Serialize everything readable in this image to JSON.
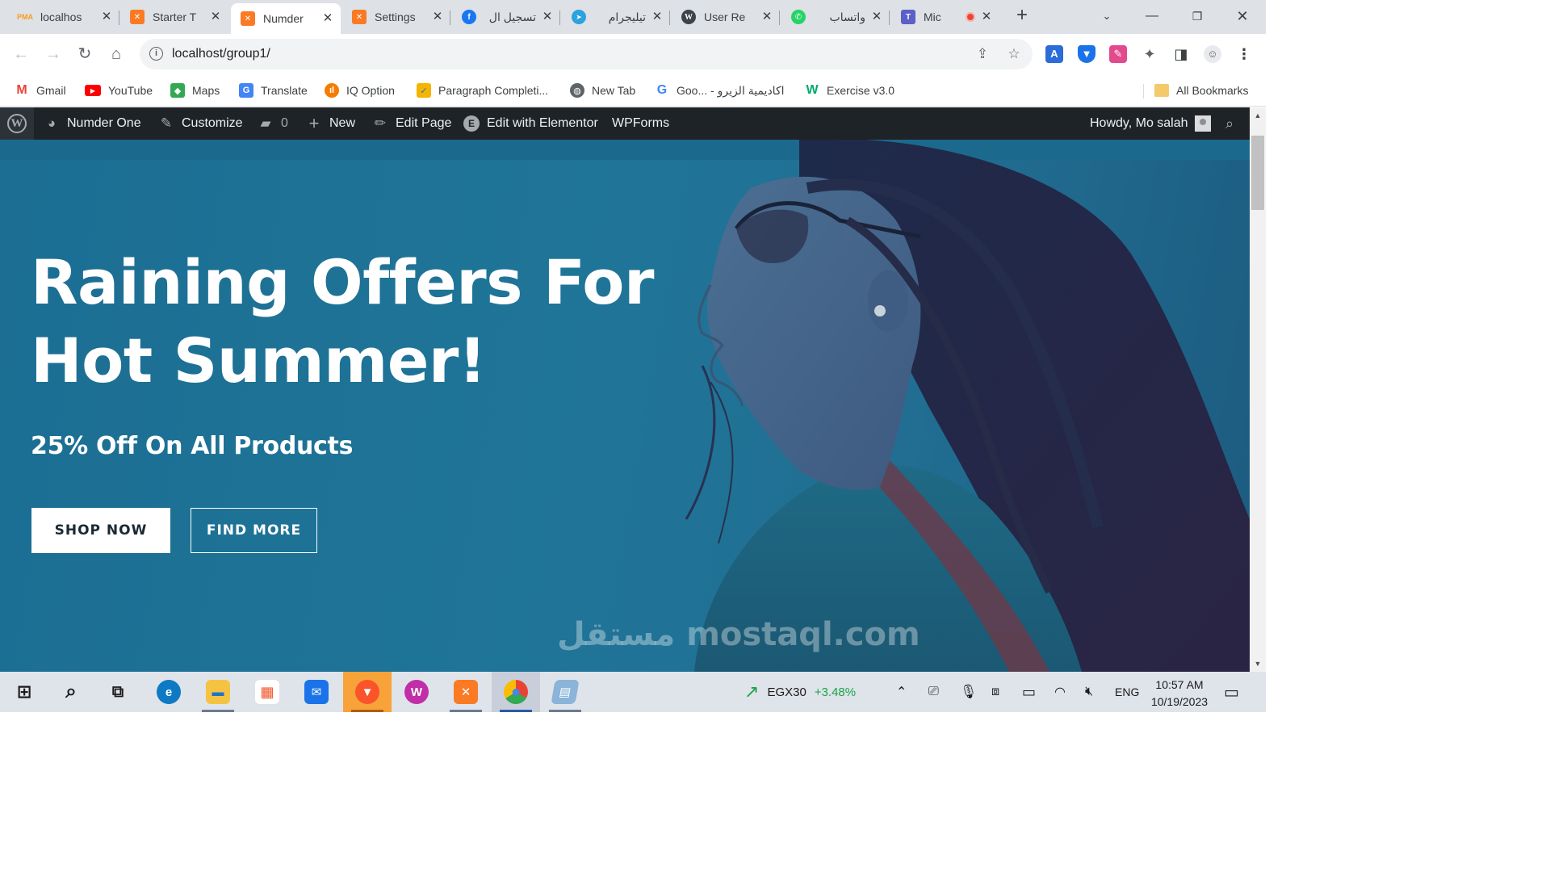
{
  "browser": {
    "tabs": [
      {
        "label": "localhos",
        "favicon": "phpmyadmin-icon",
        "color": "#f89c1c",
        "active": false
      },
      {
        "label": "Starter T",
        "favicon": "xampp-icon",
        "color": "#fb7a24",
        "active": false
      },
      {
        "label": "Numder",
        "favicon": "xampp-icon",
        "color": "#fb7a24",
        "active": true
      },
      {
        "label": "Settings",
        "favicon": "xampp-icon",
        "color": "#fb7a24",
        "active": false
      },
      {
        "label": "تسجيل ال",
        "favicon": "facebook-icon",
        "color": "#1877f2",
        "active": false
      },
      {
        "label": "تيليجرام",
        "favicon": "telegram-icon",
        "color": "#2aa3de",
        "active": false
      },
      {
        "label": "User Re",
        "favicon": "wordpress-icon",
        "color": "#3c434a",
        "active": false
      },
      {
        "label": "واتساب",
        "favicon": "whatsapp-icon",
        "color": "#25d366",
        "active": false
      },
      {
        "label": "Mic",
        "favicon": "teams-icon",
        "color": "#5b5fc7",
        "active": false
      }
    ],
    "tab_close_glyph": "✕",
    "new_tab_glyph": "+",
    "url": "localhost/group1/",
    "bookmarks": [
      {
        "label": "Gmail",
        "icon": "gmail-icon",
        "color": "#ea4335"
      },
      {
        "label": "YouTube",
        "icon": "youtube-icon",
        "color": "#ff0000"
      },
      {
        "label": "Maps",
        "icon": "maps-icon",
        "color": "#34a853"
      },
      {
        "label": "Translate",
        "icon": "translate-icon",
        "color": "#4285f4"
      },
      {
        "label": "IQ Option",
        "icon": "iqoption-icon",
        "color": "#f57c00"
      },
      {
        "label": "Paragraph Completi...",
        "icon": "checkbox-icon",
        "color": "#f4b400"
      },
      {
        "label": "New Tab",
        "icon": "globe-icon",
        "color": "#5f6368"
      },
      {
        "label": "Goo... - اكاديمية الزيرو",
        "icon": "google-icon",
        "color": "#4285f4"
      },
      {
        "label": "Exercise v3.0",
        "icon": "w3schools-icon",
        "color": "#04aa6d"
      }
    ],
    "all_bookmarks": "All Bookmarks"
  },
  "wp_admin_bar": {
    "site_name": "Numder One",
    "customize": "Customize",
    "comments_count": "0",
    "new": "New",
    "edit_page": "Edit Page",
    "edit_elementor": "Edit with Elementor",
    "wpforms": "WPForms",
    "howdy": "Howdy, Mo salah"
  },
  "hero": {
    "headline": "Raining Offers For Hot Summer!",
    "subheadline": "25% Off On All Products",
    "primary_button": "SHOP NOW",
    "secondary_button": "FIND MORE",
    "watermark": "مستقل mostaql.com"
  },
  "taskbar": {
    "ticker_name": "EGX30",
    "ticker_change": "+3.48%",
    "ticker_color": "#1aa34a",
    "language": "ENG",
    "time": "10:57 AM",
    "date": "10/19/2023"
  }
}
